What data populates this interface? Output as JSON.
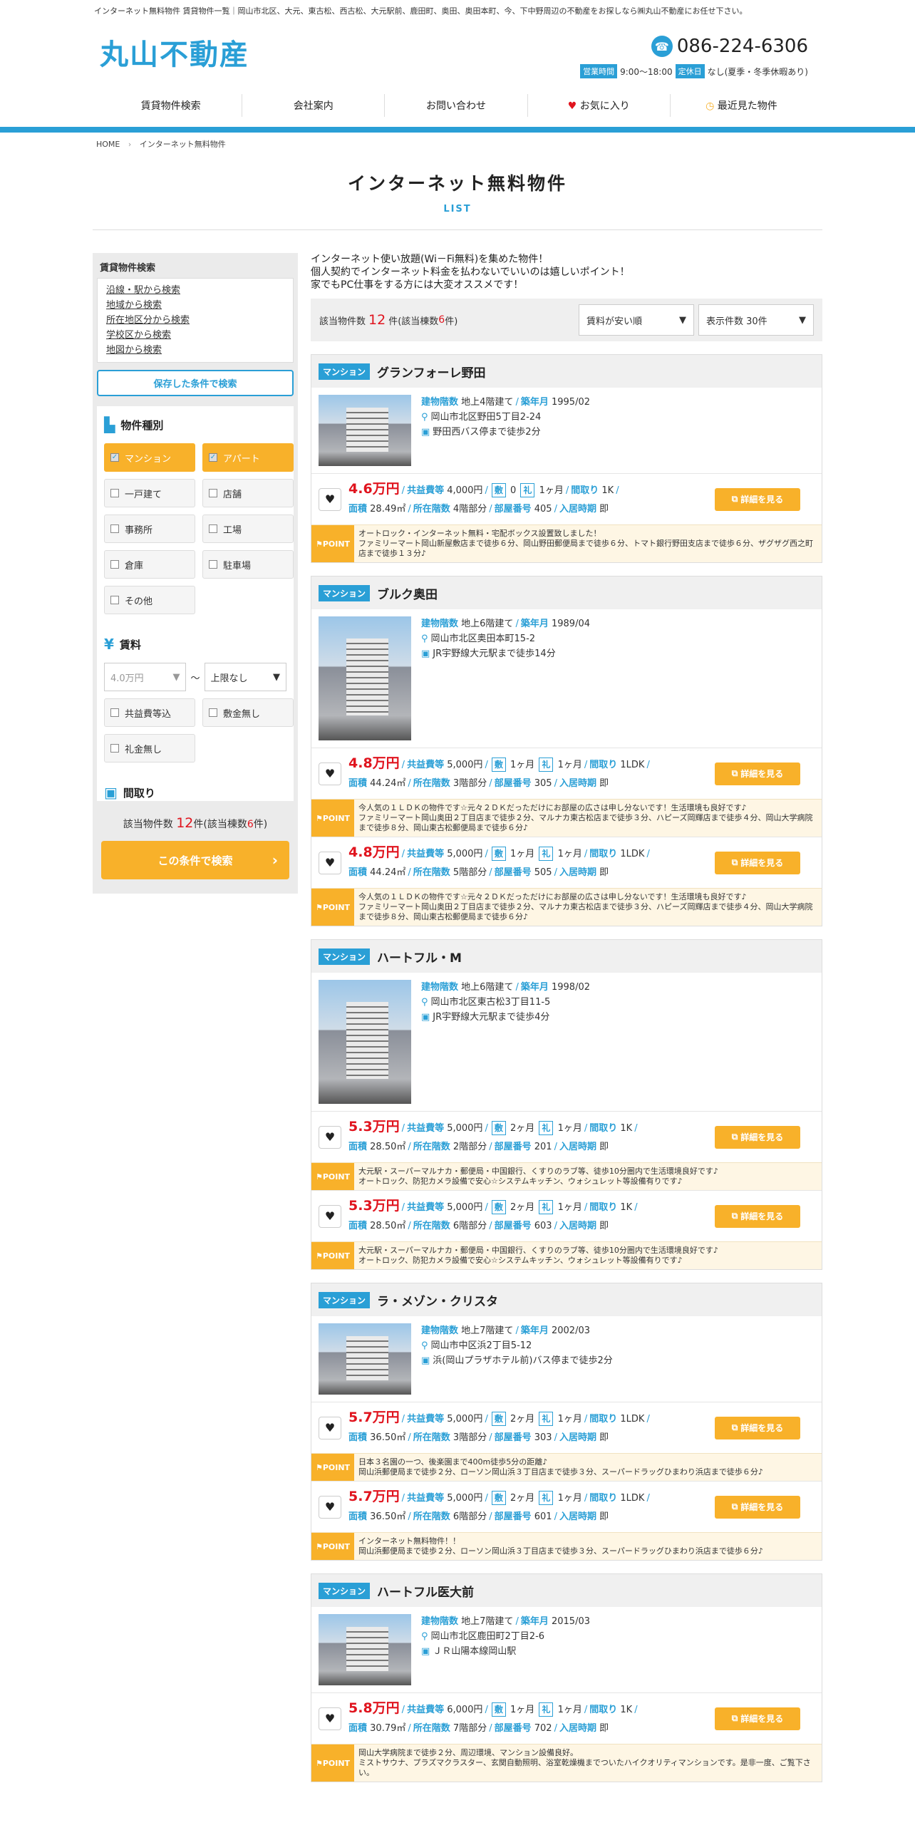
{
  "header": {
    "top_note": "インターネット無料物件 賃貸物件一覧｜岡山市北区、大元、東古松、西古松、大元駅前、鹿田町、奥田、奥田本町、今、下中野周辺の不動産をお探しなら㈱丸山不動産にお任せ下さい。",
    "logo": "丸山不動産",
    "phone": "086-224-6306",
    "hours_tag": "営業時間",
    "hours": "9:00～18:00",
    "closed_tag": "定休日",
    "closed": "なし(夏季・冬季休暇あり)"
  },
  "nav": [
    "賃貸物件検索",
    "会社案内",
    "お問い合わせ",
    "お気に入り",
    "最近見た物件"
  ],
  "breadcrumb": {
    "home": "HOME",
    "current": "インターネット無料物件"
  },
  "page": {
    "title": "インターネット無料物件",
    "subtitle": "LIST"
  },
  "sidebar": {
    "search_title": "賃貸物件検索",
    "links": [
      "沿線・駅から検索",
      "地域から検索",
      "所在地区分から検索",
      "学校区から検索",
      "地図から検索"
    ],
    "save_button": "保存した条件で検索",
    "type_title": "物件種別",
    "types": [
      {
        "label": "マンション",
        "checked": true
      },
      {
        "label": "アパート",
        "checked": true
      },
      {
        "label": "一戸建て",
        "checked": false
      },
      {
        "label": "店舗",
        "checked": false
      },
      {
        "label": "事務所",
        "checked": false
      },
      {
        "label": "工場",
        "checked": false
      },
      {
        "label": "倉庫",
        "checked": false
      },
      {
        "label": "駐車場",
        "checked": false
      },
      {
        "label": "その他",
        "checked": false
      }
    ],
    "rent_title": "賃料",
    "rent_min": "4.0万円",
    "rent_tilde": "～",
    "rent_max": "上限なし",
    "rent_opts": [
      "共益費等込",
      "敷金無し",
      "礼金無し"
    ],
    "layout_title": "間取り",
    "count_prefix": "該当物件数",
    "count": "12",
    "count_mid": "件(該当棟数",
    "bldg": "6",
    "count_suffix": "件)",
    "search_button": "この条件で検索"
  },
  "main": {
    "intro": [
      "インターネット使い放題(Wi－Fi無料)を集めた物件！",
      "個人契約でインターネット料金を払わないでいいのは嬉しいポイント！",
      "家でもPC仕事をする方には大変オススメです！"
    ],
    "count_prefix": "該当物件数",
    "count": "12",
    "count_mid": "件(該当棟数",
    "bldg": "6",
    "count_suffix": "件)",
    "sort": "賃料が安い順",
    "per_page": "表示件数 30件"
  },
  "labels": {
    "floors": "建物階数",
    "built": "築年月",
    "common": "共益費等",
    "shiki": "敷",
    "rei": "礼",
    "madori": "間取り",
    "area": "面積",
    "floor": "所在階数",
    "room": "部屋番号",
    "movein": "入居時期",
    "detail": "詳細を見る",
    "point": "POINT"
  },
  "properties": [
    {
      "type": "マンション",
      "name": "グランフォーレ野田",
      "floors": "地上4階建て",
      "built": "1995/02",
      "address": "岡山市北区野田5丁目2-24",
      "access": "野田西バス停まで徒歩2分",
      "units": [
        {
          "price": "4.6万円",
          "common": "4,000円",
          "shiki": "0",
          "rei": "1ヶ月",
          "madori": "1K",
          "area": "28.49㎡",
          "floor": "4階部分",
          "room": "405",
          "movein": "即",
          "point": "オートロック・インターネット無料・宅配ボックス設置致しました！\nファミリーマート岡山新屋敷店まで徒歩６分、岡山野田郵便局まで徒歩６分、トマト銀行野田支店まで徒歩６分、ザグザグ西之町店まで徒歩１３分♪"
        }
      ]
    },
    {
      "type": "マンション",
      "name": "ブルク奥田",
      "floors": "地上6階建て",
      "built": "1989/04",
      "address": "岡山市北区奥田本町15-2",
      "access": "JR宇野線大元駅まで徒歩14分",
      "units": [
        {
          "price": "4.8万円",
          "common": "5,000円",
          "shiki": "1ヶ月",
          "rei": "1ヶ月",
          "madori": "1LDK",
          "area": "44.24㎡",
          "floor": "3階部分",
          "room": "305",
          "movein": "即",
          "point": "今人気の１ＬＤＫの物件です☆元々２ＤＫだっただけにお部屋の広さは申し分ないです！生活環境も良好です♪\nファミリーマート岡山奥田２丁目店まで徒歩２分、マルナカ東古松店まで徒歩３分、ハピーズ岡輝店まで徒歩４分、岡山大学病院まで徒歩８分、岡山東古松郵便局まで徒歩６分♪"
        },
        {
          "price": "4.8万円",
          "common": "5,000円",
          "shiki": "1ヶ月",
          "rei": "1ヶ月",
          "madori": "1LDK",
          "area": "44.24㎡",
          "floor": "5階部分",
          "room": "505",
          "movein": "即",
          "point": "今人気の１ＬＤＫの物件です☆元々２ＤＫだっただけにお部屋の広さは申し分ないです！生活環境も良好です♪\nファミリーマート岡山奥田２丁目店まで徒歩２分、マルナカ東古松店まで徒歩３分、ハピーズ岡輝店まで徒歩４分、岡山大学病院まで徒歩８分、岡山東古松郵便局まで徒歩６分♪"
        }
      ]
    },
    {
      "type": "マンション",
      "name": "ハートフル・M",
      "floors": "地上6階建て",
      "built": "1998/02",
      "address": "岡山市北区東古松3丁目11-5",
      "access": "JR宇野線大元駅まで徒歩4分",
      "units": [
        {
          "price": "5.3万円",
          "common": "5,000円",
          "shiki": "2ヶ月",
          "rei": "1ヶ月",
          "madori": "1K",
          "area": "28.50㎡",
          "floor": "2階部分",
          "room": "201",
          "movein": "即",
          "point": "大元駅・スーパーマルナカ・郵便局・中国銀行、くすりのラブ等、徒歩10分圏内で生活環境良好です♪\nオートロック、防犯カメラ設備で安心☆システムキッチン、ウォシュレット等設備有りです♪"
        },
        {
          "price": "5.3万円",
          "common": "5,000円",
          "shiki": "2ヶ月",
          "rei": "1ヶ月",
          "madori": "1K",
          "area": "28.50㎡",
          "floor": "6階部分",
          "room": "603",
          "movein": "即",
          "point": "大元駅・スーパーマルナカ・郵便局・中国銀行、くすりのラブ等、徒歩10分圏内で生活環境良好です♪\nオートロック、防犯カメラ設備で安心☆システムキッチン、ウォシュレット等設備有りです♪"
        }
      ]
    },
    {
      "type": "マンション",
      "name": "ラ・メゾン・クリスタ",
      "floors": "地上7階建て",
      "built": "2002/03",
      "address": "岡山市中区浜2丁目5-12",
      "access": "浜(岡山プラザホテル前)バス停まで徒歩2分",
      "units": [
        {
          "price": "5.7万円",
          "common": "5,000円",
          "shiki": "2ヶ月",
          "rei": "1ヶ月",
          "madori": "1LDK",
          "area": "36.50㎡",
          "floor": "3階部分",
          "room": "303",
          "movein": "即",
          "point": "日本３名園の一つ、後楽園まで400m徒歩5分の距離♪\n岡山浜郵便局まで徒歩２分、ローソン岡山浜３丁目店まで徒歩３分、スーパードラッグひまわり浜店まで徒歩６分♪"
        },
        {
          "price": "5.7万円",
          "common": "5,000円",
          "shiki": "2ヶ月",
          "rei": "1ヶ月",
          "madori": "1LDK",
          "area": "36.50㎡",
          "floor": "6階部分",
          "room": "601",
          "movein": "即",
          "point": "インターネット無料物件！！\n岡山浜郵便局まで徒歩２分、ローソン岡山浜３丁目店まで徒歩３分、スーパードラッグひまわり浜店まで徒歩６分♪"
        }
      ]
    },
    {
      "type": "マンション",
      "name": "ハートフル医大前",
      "floors": "地上7階建て",
      "built": "2015/03",
      "address": "岡山市北区鹿田町2丁目2-6",
      "access": "ＪＲ山陽本線岡山駅",
      "units": [
        {
          "price": "5.8万円",
          "common": "6,000円",
          "shiki": "1ヶ月",
          "rei": "1ヶ月",
          "madori": "1K",
          "area": "30.79㎡",
          "floor": "7階部分",
          "room": "702",
          "movein": "即",
          "point": "岡山大学病院まで徒歩２分、周辺環境、マンション設備良好。\nミストサウナ、プラズマクラスター、玄関自動照明、浴室乾燥機までついたハイクオリティマンションです。是非一度、ご覧下さい。"
        }
      ]
    }
  ]
}
